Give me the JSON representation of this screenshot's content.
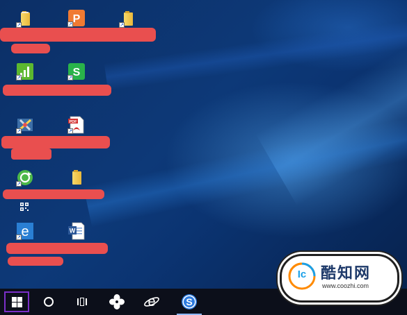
{
  "desktop": {
    "icons": [
      {
        "id": "folder-1",
        "glyph": "folder-icon"
      },
      {
        "id": "wps-presentation",
        "glyph": "wps-presentation-icon",
        "letter": "P",
        "color": "#f07a32"
      },
      {
        "id": "folder-2",
        "glyph": "folder-icon"
      },
      {
        "id": "wps-spreadsheet-green-bars",
        "glyph": "bar-chart-app-icon",
        "color": "#5cb82f"
      },
      {
        "id": "wps-spreadsheet",
        "glyph": "wps-spreadsheet-icon",
        "letter": "S",
        "color": "#29b34a"
      },
      {
        "id": "tool-app",
        "glyph": "tool-app-icon"
      },
      {
        "id": "pdf-reader",
        "glyph": "pdf-icon",
        "label": "PDF"
      },
      {
        "id": "refresh-app",
        "glyph": "green-refresh-icon",
        "color": "#4cb848"
      },
      {
        "id": "folder-3",
        "glyph": "folder-icon"
      },
      {
        "id": "qr-app",
        "glyph": "qr-code-icon"
      },
      {
        "id": "ie-shortcut",
        "glyph": "internet-explorer-icon",
        "letter": "e",
        "color": "#2a7fd4"
      },
      {
        "id": "word-doc",
        "glyph": "word-document-icon",
        "letter": "W",
        "color": "#2b5797"
      }
    ],
    "redaction_color": "#e94f4f"
  },
  "taskbar": {
    "items": [
      {
        "name": "start",
        "icon": "windows-logo-icon"
      },
      {
        "name": "cortana",
        "icon": "cortana-circle-icon"
      },
      {
        "name": "task-view",
        "icon": "task-view-icon"
      },
      {
        "name": "pinwheel-app",
        "icon": "pinwheel-icon"
      },
      {
        "name": "internet-explorer",
        "icon": "internet-explorer-icon",
        "letter": "e"
      },
      {
        "name": "sogou-browser",
        "icon": "sogou-s-icon",
        "letter": "S",
        "active": true
      }
    ],
    "start_highlight_color": "#7b2fc9"
  },
  "watermark": {
    "brand": "酷知网",
    "url": "www.coozhi.com",
    "logo_letters": "Ic"
  }
}
